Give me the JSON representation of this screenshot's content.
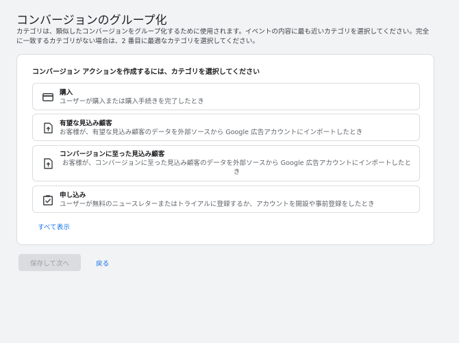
{
  "page": {
    "title": "コンバージョンのグループ化",
    "description": "カテゴリは、類似したコンバージョンをグループ化するために使用されます。イベントの内容に最も近いカテゴリを選択してください。完全に一致するカテゴリがない場合は、2 番目に最適なカテゴリを選択してください。"
  },
  "card": {
    "heading": "コンバージョン アクションを作成するには、カテゴリを選択してください",
    "options": [
      {
        "icon": "credit-card-icon",
        "title": "購入",
        "description": "ユーザーが購入または購入手続きを完了したとき"
      },
      {
        "icon": "file-upload-icon",
        "title": "有望な見込み顧客",
        "description": "お客様が、有望な見込み顧客のデータを外部ソースから Google 広告アカウントにインポートしたとき"
      },
      {
        "icon": "file-upload-icon",
        "title": "コンバージョンに至った見込み顧客",
        "description": "お客様が、コンバージョンに至った見込み顧客のデータを外部ソースから Google 広告アカウントにインポートしたとき"
      },
      {
        "icon": "checkbox-checked-icon",
        "title": "申し込み",
        "description": "ユーザーが無料のニュースレターまたはトライアルに登録するか、アカウントを開設や事前登録をしたとき"
      }
    ],
    "show_all": "すべて表示"
  },
  "footer": {
    "save_label": "保存して次へ",
    "back_label": "戻る"
  },
  "colors": {
    "accent": "#1a73e8",
    "background": "#f1f3f4",
    "disabled_button": "#dadce0"
  }
}
